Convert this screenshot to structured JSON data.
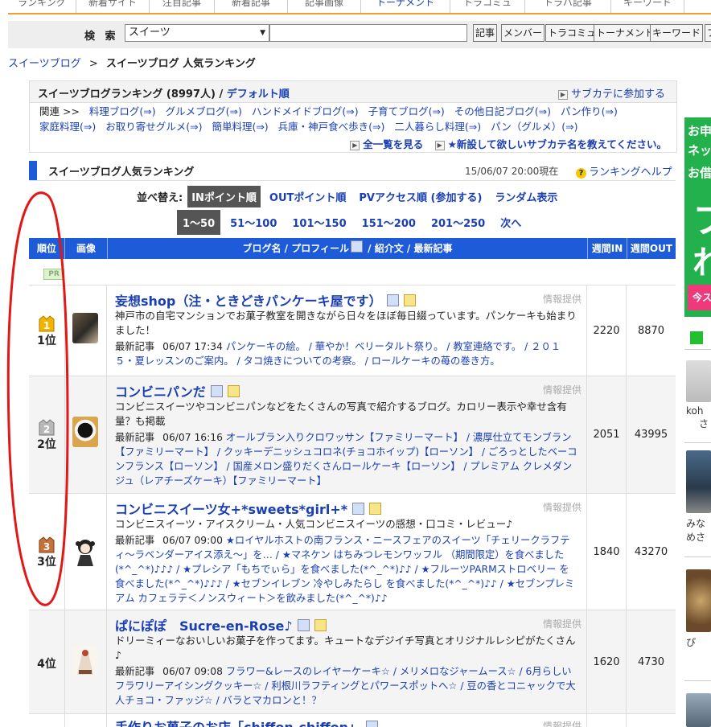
{
  "topnav": {
    "tabs": [
      "ランキング",
      "新着サイト",
      "注目記事",
      "新着記事",
      "記事画像",
      "トーナメント",
      "トラコミュ",
      "トラバ記事",
      "キーワード"
    ]
  },
  "search": {
    "label": "検 索",
    "select_value": "スイーツ",
    "query": "",
    "buttons": [
      "記事",
      "メンバー",
      "トラコミュ",
      "トーナメント",
      "キーワード",
      "プ"
    ]
  },
  "breadcrumb": {
    "parent": "スイーツブログ",
    "sep": ">",
    "current": "スイーツブログ 人気ランキング"
  },
  "category": {
    "title": "スイーツブログランキング (8997人)",
    "slash": " / ",
    "default_order": "デフォルト順",
    "join_sub": "サブカテに参加する",
    "related_label": "関連 >>",
    "related": [
      "料理ブログ(⇒)",
      "グルメブログ(⇒)",
      "ハンドメイドブログ(⇒)",
      "子育てブログ(⇒)",
      "その他日記ブログ(⇒)",
      "パン作り(⇒)",
      "家庭料理(⇒)",
      "お取り寄せグルメ(⇒)",
      "簡単料理(⇒)",
      "兵庫・神戸食べ歩き(⇒)",
      "二人暮らし料理(⇒)",
      "パン（グルメ）(⇒)"
    ],
    "see_all": "全一覧を見る",
    "request_sub": "★新設して欲しいサブカテ名を教えてください。"
  },
  "ranking": {
    "title": "スイーツブログ人気ランキング",
    "datetime": "15/06/07 20:00現在",
    "help": "ランキングヘルプ",
    "sort_label": "並べ替え:",
    "sort_options": [
      "INポイント順",
      "OUTポイント順",
      "PVアクセス順 (参加する)",
      "ランダム表示"
    ],
    "sort_active": 0,
    "pages": [
      "1～50",
      "51～100",
      "101～150",
      "151～200",
      "201～250",
      "次へ"
    ],
    "page_active": 0,
    "headers": {
      "rank": "順位",
      "image": "画像",
      "blog": "ブログ名 / プロフィール",
      "blog_rest": " / 紹介文 / 最新記事",
      "in": "週間IN",
      "out": "週間OUT"
    },
    "pr": "PR",
    "latest_label": "最新記事",
    "source_label": "情報提供",
    "rows": [
      {
        "rank": "1位",
        "title": "妄想shop（注・ときどきパンケーキ屋です）",
        "desc": "神戸市の自宅マンションでお菓子教室を開きながら日々をほぼ毎日綴っています。パンケーキも始まりました！",
        "latest_time": "06/07 17:34",
        "latest": "パンケーキの絵。 / 華やか！ベリータルト祭り。 / 教室連絡です。 / ２０１５・夏レッスンのご案内。 / タコ焼きについての考察。 / ロールケーキの苺の巻き方。",
        "in": "2220",
        "out": "8870"
      },
      {
        "rank": "2位",
        "title": "コンビニパンだ",
        "desc": "コンビニスイーツやコンビニパンなどをたくさんの写真で紹介するブログ。カロリー表示や幸せ含有量？も掲載",
        "latest_time": "06/07 16:16",
        "latest": "オールブラン入りクロワッサン【ファミリーマート】 / 濃厚仕立てモンブラン【ファミリーマート】 / クッキーデニッシュコロネ(チョコホイップ)【ローソン】 / ごろっとしたベーコンフランス【ローソン】 / 国産メロン盛りだくさんロールケーキ【ローソン】 / プレミアム クレメダンジュ（レアチーズケーキ）【ファミリーマート】",
        "in": "2051",
        "out": "43995"
      },
      {
        "rank": "3位",
        "title": "コンビニスイーツ女+*sweets*girl+*",
        "desc": "コンビニスイーツ・アイスクリーム・人気コンビニスイーツの感想・口コミ・レビュー♪",
        "latest_time": "06/07 09:00",
        "latest": "★ロイヤルホストの南フランス・ニースフェアのスイーツ「チェリークラフティ〜ラベンダーアイス添え〜」を… / ★マネケン はちみつレモンワッフル （期間限定）を食べました(*^_^*)♪♪♪ / ★プレシア「もちでぃら」を食べました(*^_^*)♪♪ / ★フルーツPARMストロベリー を食べました(*^_^*)♪♪♪ / ★セブンイレブン 冷やしみたらし を食べました(*^_^*)♪♪ / ★セブンプレミアム カフェラテ＜ノンスウィート＞を飲みました(*^_^*)♪♪",
        "in": "1840",
        "out": "43270"
      },
      {
        "rank": "4位",
        "title": "ぱにぽぽ　Sucre-en-Rose♪",
        "desc": "ドリーミィーなおいしいお菓子を作ってます。キュートなデジイチ写真とオリジナルレシピがたくさん♪",
        "latest_time": "06/07 09:08",
        "latest": "フラワー&レースのレイヤーケーキ☆ / メリメロなジャームース☆ / 6月らしいフラワリーアイシングクッキー☆ / 利根川ラフティングとパワースポットへ☆ / 豆の香とコニャックで大人チョコ・ファッジ☆ / バラとマカロンと！？",
        "in": "1620",
        "out": "4730"
      },
      {
        "rank": "",
        "title": "手作りお菓子のお店「chiffon-chiffon」",
        "desc": "",
        "latest_time": "",
        "latest": "",
        "in": "",
        "out": ""
      }
    ]
  },
  "side": {
    "banner_lines": [
      "お申",
      "ネッ",
      "お借"
    ],
    "banner_big": [
      "フ",
      "れ"
    ],
    "banner_button": "今ス",
    "items": [
      "koh",
      "さ",
      "みな",
      "めさ",
      "ぴ"
    ]
  },
  "colors": {
    "accent_blue": "#1e5bd8",
    "link_blue": "#1a3fb4",
    "nav_orange": "#f0a030",
    "banner_green": "#22b14c",
    "annotation_red": "#e01818"
  }
}
